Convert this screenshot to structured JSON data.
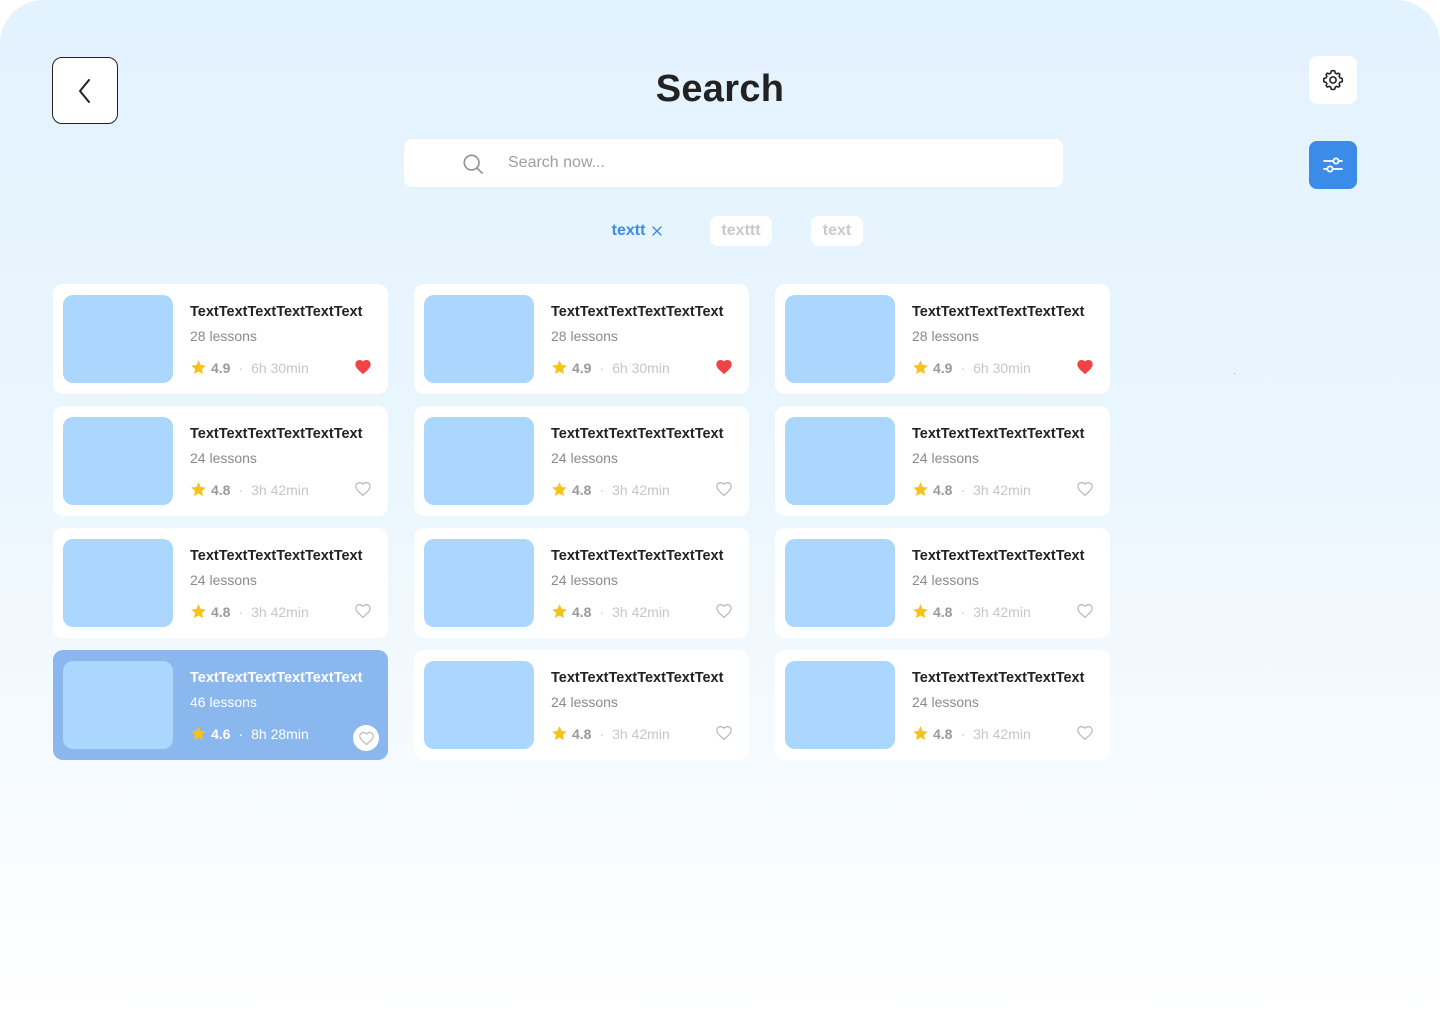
{
  "header": {
    "title": "Search",
    "back_icon": "chevron-left-icon",
    "settings_icon": "gear-icon",
    "filter_icon": "sliders-icon"
  },
  "search": {
    "placeholder": "Search now...",
    "value": "",
    "icon": "search-icon"
  },
  "chips": [
    {
      "label": "textt",
      "active": true,
      "removable": true
    },
    {
      "label": "texttt",
      "active": false
    },
    {
      "label": "text",
      "active": false
    }
  ],
  "colors": {
    "accent": "#3b8ce8",
    "thumbnail": "#abd6fd",
    "selected_card": "#8ab8ee",
    "star": "#f7c21a",
    "heart_filled": "#f04444",
    "heart_outline": "#b8b8b8"
  },
  "courses": [
    {
      "title": "TextTextTextTextTextText",
      "lessons": "28 lessons",
      "rating": "4.9",
      "duration": "6h 30min",
      "favorite": true,
      "selected": false
    },
    {
      "title": "TextTextTextTextTextText",
      "lessons": "28 lessons",
      "rating": "4.9",
      "duration": "6h 30min",
      "favorite": true,
      "selected": false
    },
    {
      "title": "TextTextTextTextTextText",
      "lessons": "28 lessons",
      "rating": "4.9",
      "duration": "6h 30min",
      "favorite": true,
      "selected": false
    },
    {
      "title": "TextTextTextTextTextText",
      "lessons": "24 lessons",
      "rating": "4.8",
      "duration": "3h 42min",
      "favorite": false,
      "selected": false
    },
    {
      "title": "TextTextTextTextTextText",
      "lessons": "24 lessons",
      "rating": "4.8",
      "duration": "3h 42min",
      "favorite": false,
      "selected": false
    },
    {
      "title": "TextTextTextTextTextText",
      "lessons": "24 lessons",
      "rating": "4.8",
      "duration": "3h 42min",
      "favorite": false,
      "selected": false
    },
    {
      "title": "TextTextTextTextTextText",
      "lessons": "24 lessons",
      "rating": "4.8",
      "duration": "3h 42min",
      "favorite": false,
      "selected": false
    },
    {
      "title": "TextTextTextTextTextText",
      "lessons": "24 lessons",
      "rating": "4.8",
      "duration": "3h 42min",
      "favorite": false,
      "selected": false
    },
    {
      "title": "TextTextTextTextTextText",
      "lessons": "24 lessons",
      "rating": "4.8",
      "duration": "3h 42min",
      "favorite": false,
      "selected": false
    },
    {
      "title": "TextTextTextTextTextText",
      "lessons": "46 lessons",
      "rating": "4.6",
      "duration": "8h 28min",
      "favorite": false,
      "selected": true
    },
    {
      "title": "TextTextTextTextTextText",
      "lessons": "24 lessons",
      "rating": "4.8",
      "duration": "3h 42min",
      "favorite": false,
      "selected": false
    },
    {
      "title": "TextTextTextTextTextText",
      "lessons": "24 lessons",
      "rating": "4.8",
      "duration": "3h 42min",
      "favorite": false,
      "selected": false
    }
  ]
}
